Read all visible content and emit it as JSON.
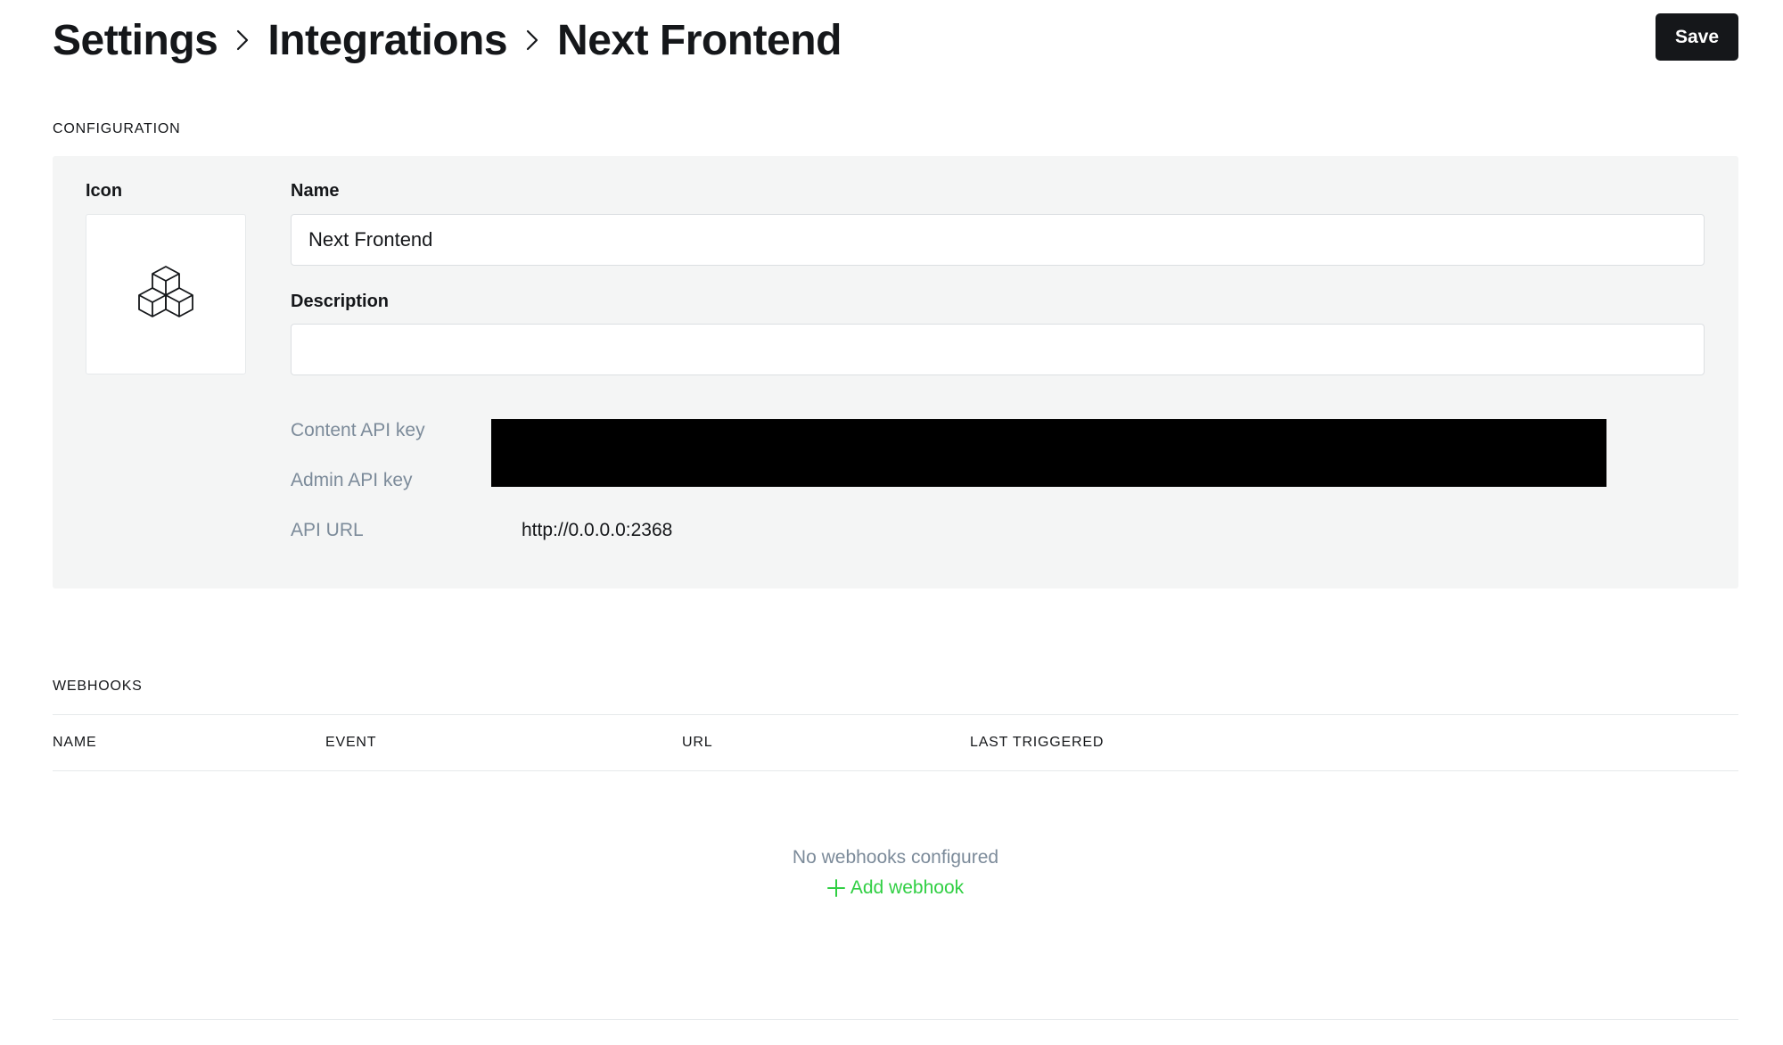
{
  "breadcrumb": {
    "items": [
      "Settings",
      "Integrations",
      "Next Frontend"
    ]
  },
  "toolbar": {
    "save_label": "Save"
  },
  "configuration": {
    "section_title": "CONFIGURATION",
    "icon_label": "Icon",
    "icon_name": "cubes-icon",
    "name_label": "Name",
    "name_value": "Next Frontend",
    "description_label": "Description",
    "description_value": "",
    "content_api_key_label": "Content API key",
    "admin_api_key_label": "Admin API key",
    "api_url_label": "API URL",
    "api_url_value": "http://0.0.0.0:2368"
  },
  "webhooks": {
    "section_title": "WEBHOOKS",
    "columns": [
      "NAME",
      "EVENT",
      "URL",
      "LAST TRIGGERED"
    ],
    "rows": [],
    "empty_text": "No webhooks configured",
    "add_label": "Add webhook"
  },
  "colors": {
    "text": "#15171a",
    "muted": "#7c8b9a",
    "panel_bg": "#f4f5f5",
    "accent_green": "#30cf43",
    "button_bg": "#15171a"
  }
}
